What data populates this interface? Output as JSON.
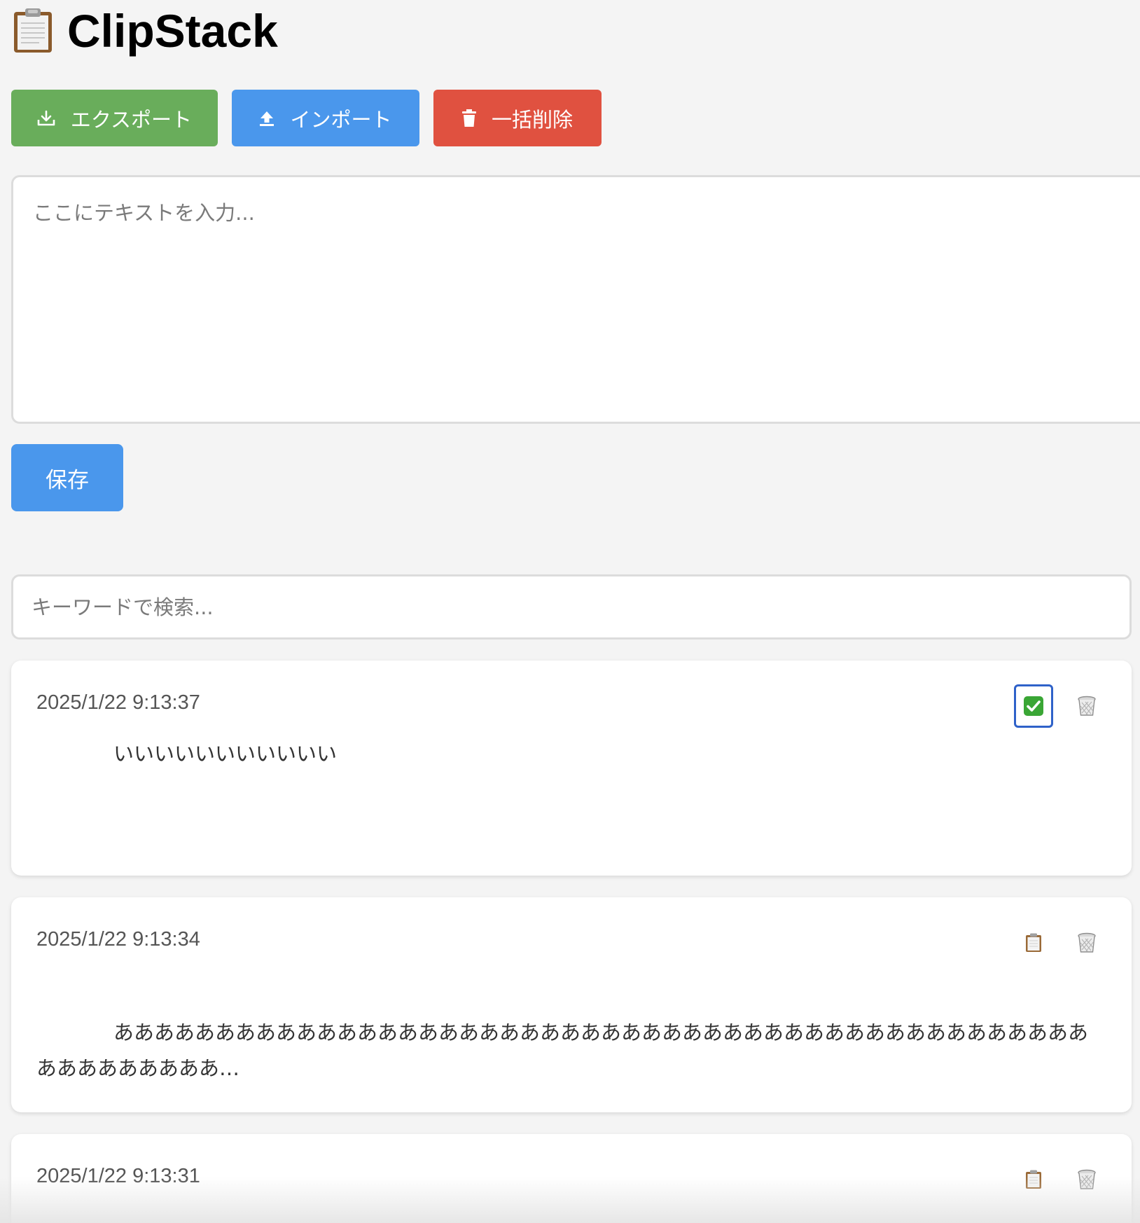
{
  "header": {
    "title": "ClipStack",
    "title_icon": "clipboard-icon"
  },
  "toolbar": {
    "export_label": "エクスポート",
    "export_icon": "download-icon",
    "export_color": "#69ad5b",
    "import_label": "インポート",
    "import_icon": "upload-icon",
    "import_color": "#4a97ec",
    "delete_all_label": "一括削除",
    "delete_all_icon": "trash-icon",
    "delete_all_color": "#e05140"
  },
  "editor": {
    "placeholder": "ここにテキストを入力...",
    "value": "",
    "save_label": "保存"
  },
  "search": {
    "placeholder": "キーワードで検索...",
    "value": ""
  },
  "clips": [
    {
      "timestamp": "2025/1/22 9:13:37",
      "text": "いいいいいいいいいいい",
      "copy_icon": "check-mark-icon",
      "delete_icon": "wastebasket-icon"
    },
    {
      "timestamp": "2025/1/22 9:13:34",
      "text": "あああああああああああああああああああああああああああああああああああああああああああああああああああああああああ…",
      "copy_icon": "clipboard-icon",
      "delete_icon": "wastebasket-icon"
    },
    {
      "timestamp": "2025/1/22 9:13:31",
      "text": "",
      "copy_icon": "clipboard-icon",
      "delete_icon": "wastebasket-icon"
    }
  ]
}
